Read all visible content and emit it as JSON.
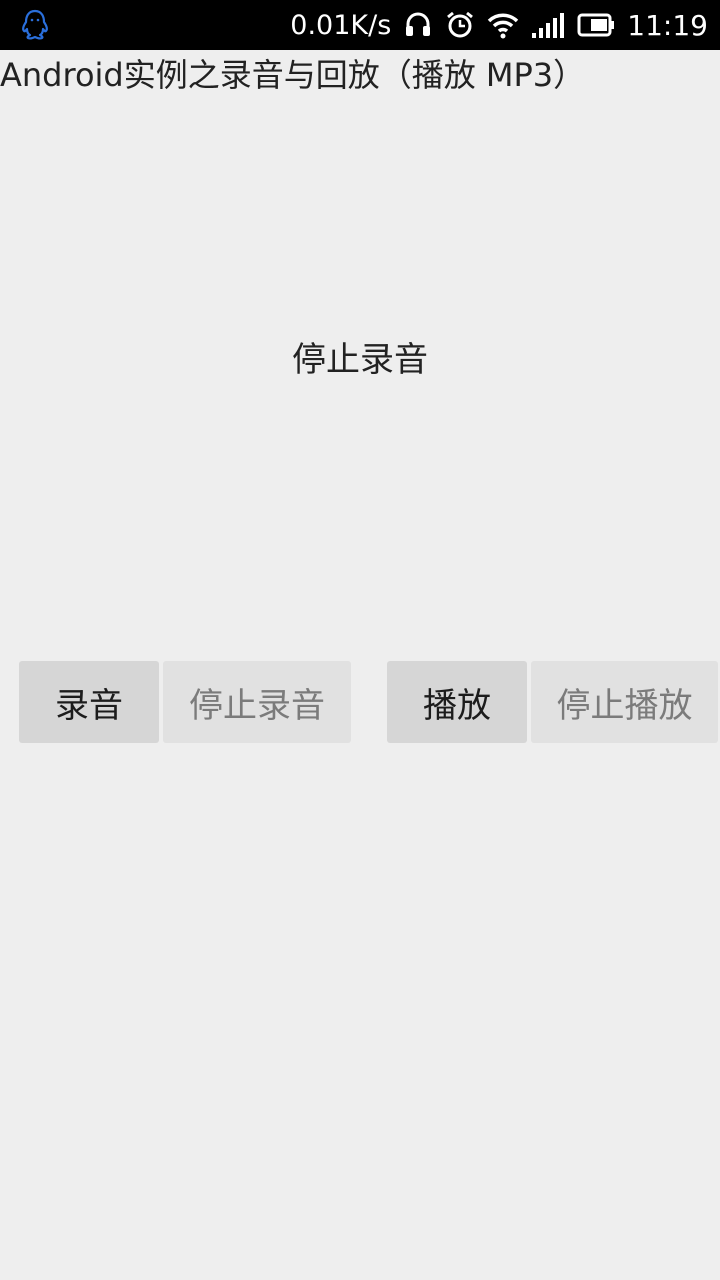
{
  "status_bar": {
    "network_speed": "0.01K/s",
    "time": "11:19",
    "icons": [
      "qq-icon",
      "headphones-icon",
      "alarm-icon",
      "wifi-icon",
      "signal-icon",
      "battery-icon"
    ]
  },
  "page": {
    "title": "Android实例之录音与回放（播放 MP3）",
    "status_message": "停止录音"
  },
  "buttons": {
    "record": {
      "label": "录音",
      "enabled": true
    },
    "stop_record": {
      "label": "停止录音",
      "enabled": false
    },
    "play": {
      "label": "播放",
      "enabled": true
    },
    "stop_play": {
      "label": "停止播放",
      "enabled": false
    }
  },
  "colors": {
    "background": "#eeeeee",
    "status_bar": "#000000",
    "qq_icon": "#2a6fdc",
    "button_enabled": "#d6d6d6",
    "button_disabled": "#e1e1e1",
    "text_disabled": "#7b7b7b"
  }
}
